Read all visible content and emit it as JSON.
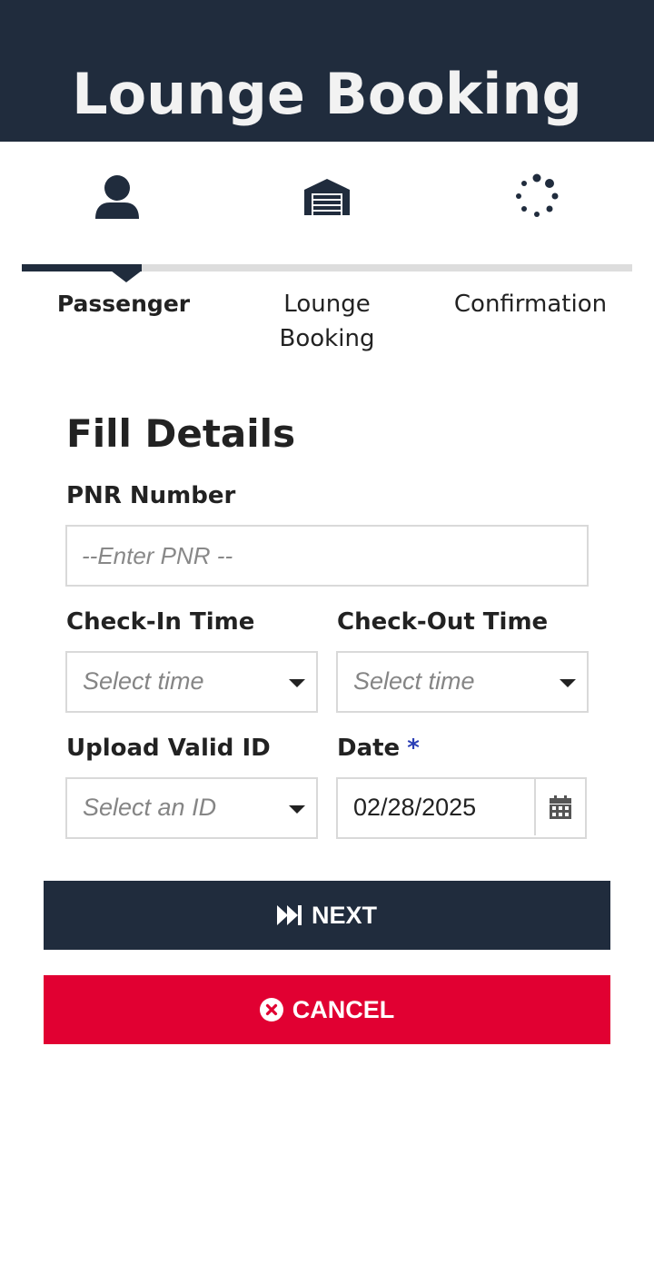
{
  "header": {
    "title": "Lounge Booking"
  },
  "steps": [
    {
      "label": "Passenger",
      "icon": "user-icon",
      "active": true
    },
    {
      "label": "Lounge\nBooking",
      "icon": "garage-icon",
      "active": false
    },
    {
      "label": "Confirmation",
      "icon": "spinner-icon",
      "active": false
    }
  ],
  "progress": {
    "current_step": 1,
    "total_steps": 3
  },
  "form": {
    "title": "Fill Details",
    "pnr": {
      "label": "PNR Number",
      "placeholder": "--Enter PNR --",
      "value": ""
    },
    "check_in": {
      "label": "Check-In Time",
      "placeholder": "Select time"
    },
    "check_out": {
      "label": "Check-Out Time",
      "placeholder": "Select time"
    },
    "valid_id": {
      "label": "Upload Valid ID",
      "placeholder": "Select an ID"
    },
    "date": {
      "label": "Date",
      "required_mark": "*",
      "value": "02/28/2025"
    }
  },
  "actions": {
    "next_label": "NEXT",
    "next_icon": "fast-forward-icon",
    "cancel_label": "CANCEL",
    "cancel_icon": "close-circle-icon"
  },
  "colors": {
    "primary": "#202c3d",
    "danger": "#e10032",
    "required": "#2b3fb5",
    "track": "#dddddd"
  }
}
